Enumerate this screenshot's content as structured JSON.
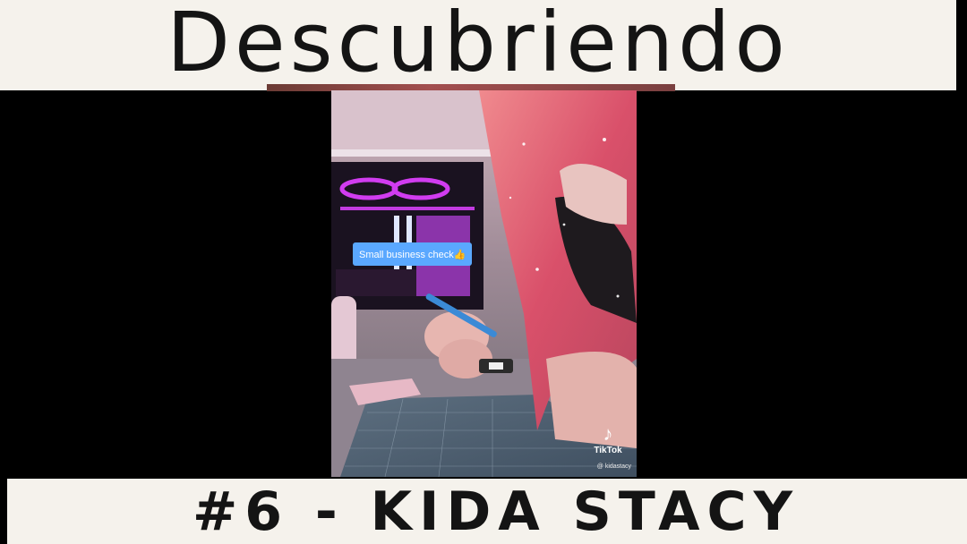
{
  "header": {
    "title": "Descubriendo"
  },
  "footer": {
    "subtitle": "#6 - KIDA STACY"
  },
  "video": {
    "caption": "Small business check👍",
    "watermark": "TikTok",
    "handle": "@ kidastacy",
    "logo_icon": "tiktok-note-icon"
  },
  "colors": {
    "banner_background": "#f5f2ec",
    "banner_text": "#141414",
    "letterbox": "#000000",
    "caption_chip": "#5aa8ff",
    "hair": "#e0707a",
    "neon": "#d13cf0"
  }
}
